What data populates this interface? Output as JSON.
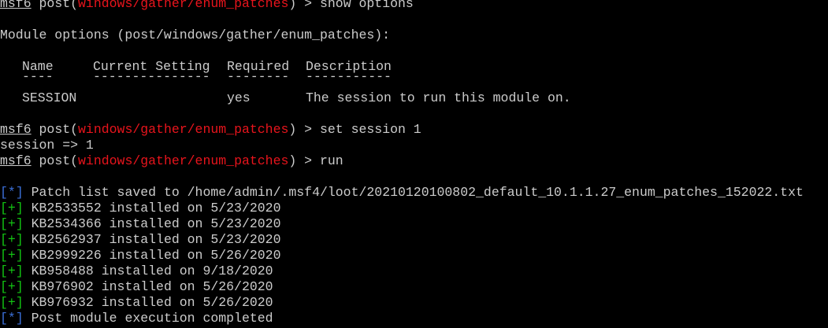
{
  "terminal": {
    "prompt": {
      "name": "msf6",
      "prefix": " post(",
      "module": "windows/gather/enum_patches",
      "suffix": ") > "
    },
    "commands": {
      "show": "show options",
      "set": "set session 1",
      "run": "run"
    },
    "module_options_header": "Module options (post/windows/gather/enum_patches):",
    "options_table": {
      "columns": [
        "Name",
        "Current Setting",
        "Required",
        "Description"
      ],
      "underlines": [
        "----",
        "---------------",
        "--------",
        "-----------"
      ],
      "rows": [
        {
          "name": "SESSION",
          "current_setting": "",
          "required": "yes",
          "description": "The session to run this module on."
        }
      ]
    },
    "set_output": "session => 1",
    "output": [
      {
        "marker_open": "[",
        "marker_symbol": "*",
        "marker_close": "]",
        "color": "blue",
        "text": " Patch list saved to /home/admin/.msf4/loot/20210120100802_default_10.1.1.27_enum_patches_152022.txt"
      },
      {
        "marker_open": "[",
        "marker_symbol": "+",
        "marker_close": "]",
        "color": "green",
        "text": " KB2533552 installed on 5/23/2020"
      },
      {
        "marker_open": "[",
        "marker_symbol": "+",
        "marker_close": "]",
        "color": "green",
        "text": " KB2534366 installed on 5/23/2020"
      },
      {
        "marker_open": "[",
        "marker_symbol": "+",
        "marker_close": "]",
        "color": "green",
        "text": " KB2562937 installed on 5/23/2020"
      },
      {
        "marker_open": "[",
        "marker_symbol": "+",
        "marker_close": "]",
        "color": "green",
        "text": " KB2999226 installed on 5/26/2020"
      },
      {
        "marker_open": "[",
        "marker_symbol": "+",
        "marker_close": "]",
        "color": "green",
        "text": " KB958488 installed on 9/18/2020"
      },
      {
        "marker_open": "[",
        "marker_symbol": "+",
        "marker_close": "]",
        "color": "green",
        "text": " KB976902 installed on 5/26/2020"
      },
      {
        "marker_open": "[",
        "marker_symbol": "+",
        "marker_close": "]",
        "color": "green",
        "text": " KB976932 installed on 5/26/2020"
      },
      {
        "marker_open": "[",
        "marker_symbol": "*",
        "marker_close": "]",
        "color": "blue",
        "text": " Post module execution completed"
      }
    ],
    "colors": {
      "background": "#000000",
      "foreground": "#cccccc",
      "module": "#e8141c",
      "success": "#13c313",
      "info": "#3b6fd8"
    }
  }
}
